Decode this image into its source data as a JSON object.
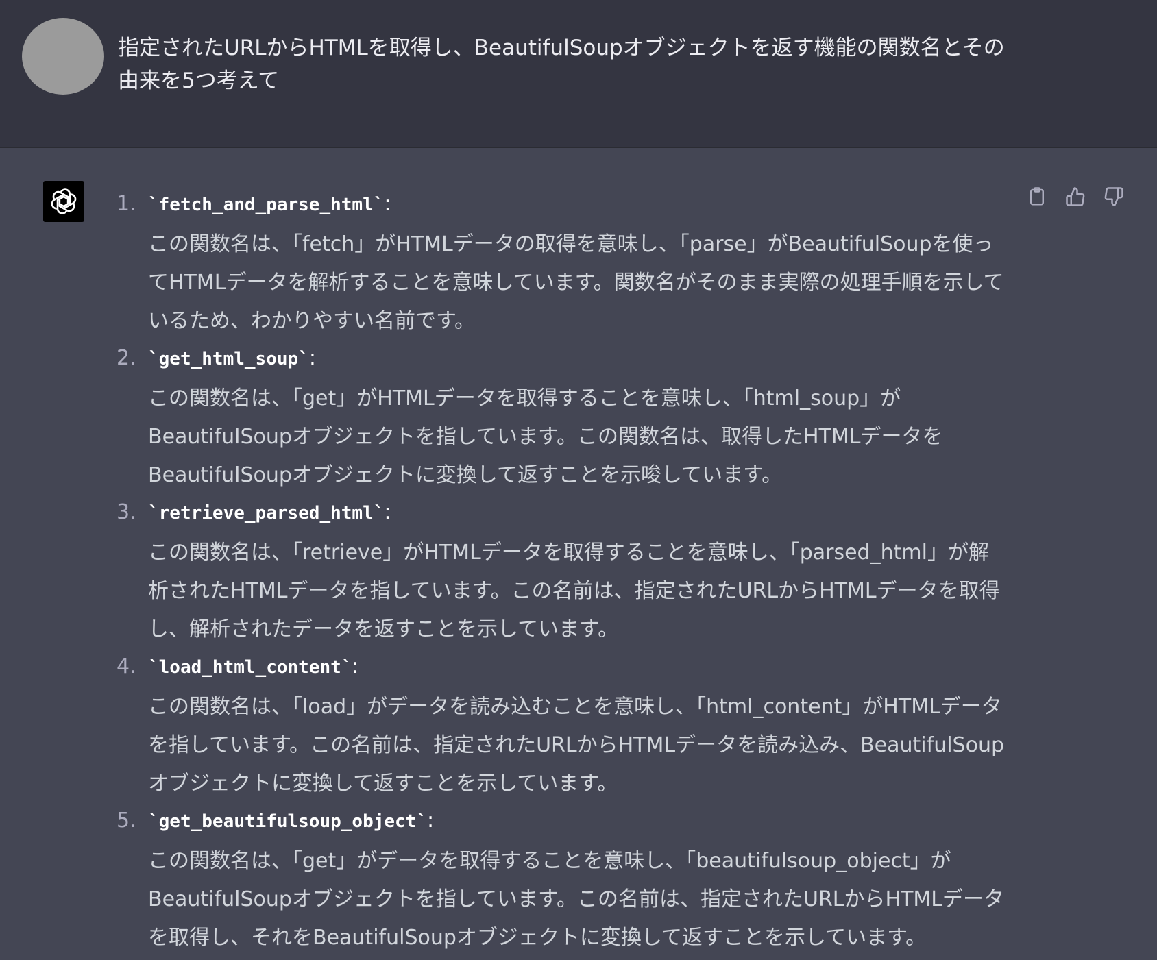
{
  "user": {
    "message": "指定されたURLからHTMLを取得し、BeautifulSoupオブジェクトを返す機能の関数名とその由来を5つ考えて"
  },
  "actions": {
    "copy": "copy-icon",
    "thumbs_up": "thumbs-up-icon",
    "thumbs_down": "thumbs-down-icon"
  },
  "answer": {
    "items": [
      {
        "number": "1.",
        "name": "fetch_and_parse_html",
        "description": "この関数名は、「fetch」がHTMLデータの取得を意味し、「parse」がBeautifulSoupを使ってHTMLデータを解析することを意味しています。関数名がそのまま実際の処理手順を示しているため、わかりやすい名前です。"
      },
      {
        "number": "2.",
        "name": "get_html_soup",
        "description": "この関数名は、「get」がHTMLデータを取得することを意味し、「html_soup」がBeautifulSoupオブジェクトを指しています。この関数名は、取得したHTMLデータをBeautifulSoupオブジェクトに変換して返すことを示唆しています。"
      },
      {
        "number": "3.",
        "name": "retrieve_parsed_html",
        "description": "この関数名は、「retrieve」がHTMLデータを取得することを意味し、「parsed_html」が解析されたHTMLデータを指しています。この名前は、指定されたURLからHTMLデータを取得し、解析されたデータを返すことを示しています。"
      },
      {
        "number": "4.",
        "name": "load_html_content",
        "description": "この関数名は、「load」がデータを読み込むことを意味し、「html_content」がHTMLデータを指しています。この名前は、指定されたURLからHTMLデータを読み込み、BeautifulSoupオブジェクトに変換して返すことを示しています。"
      },
      {
        "number": "5.",
        "name": "get_beautifulsoup_object",
        "description": "この関数名は、「get」がデータを取得することを意味し、「beautifulsoup_object」がBeautifulSoupオブジェクトを指しています。この名前は、指定されたURLからHTMLデータを取得し、それをBeautifulSoupオブジェクトに変換して返すことを示しています。"
      }
    ]
  },
  "colors": {
    "user_bg": "#343541",
    "assistant_bg": "#444654",
    "text": "#d1d5db",
    "avatar": "#9b9b9b"
  }
}
